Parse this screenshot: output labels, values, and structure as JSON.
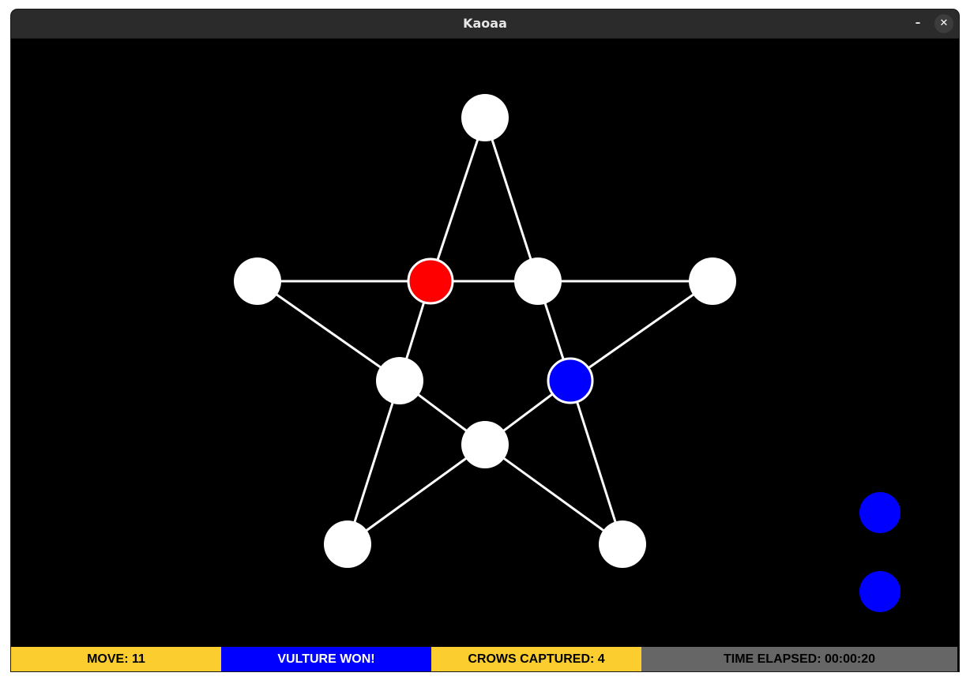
{
  "window": {
    "title": "Kaoaa",
    "minimize_glyph": "–",
    "close_glyph": "✕"
  },
  "board": {
    "background_color": "#000000",
    "line_color": "#ffffff",
    "empty_node_color": "#ffffff",
    "crow_color": "#ff0000",
    "vulture_color": "#0000ff",
    "nodes": [
      {
        "id": "top-point",
        "state": "empty"
      },
      {
        "id": "left-point",
        "state": "empty"
      },
      {
        "id": "inner-top-left",
        "state": "crow"
      },
      {
        "id": "inner-top-right",
        "state": "empty"
      },
      {
        "id": "right-point",
        "state": "empty"
      },
      {
        "id": "inner-left",
        "state": "empty"
      },
      {
        "id": "inner-right",
        "state": "vulture"
      },
      {
        "id": "inner-bottom",
        "state": "empty"
      },
      {
        "id": "bottom-left-point",
        "state": "empty"
      },
      {
        "id": "bottom-right-point",
        "state": "empty"
      }
    ]
  },
  "captured_crows": {
    "color": "#0000ff",
    "shown": 2
  },
  "status": {
    "move": "MOVE: 11",
    "winner": "VULTURE WON!",
    "crows_captured": "CROWS CAPTURED: 4",
    "time_elapsed": "TIME ELAPSED: 00:00:20",
    "colors": {
      "move_bg": "#fbcd2f",
      "winner_bg": "#0000ff",
      "crows_bg": "#fbcd2f",
      "time_bg": "#666666"
    }
  }
}
